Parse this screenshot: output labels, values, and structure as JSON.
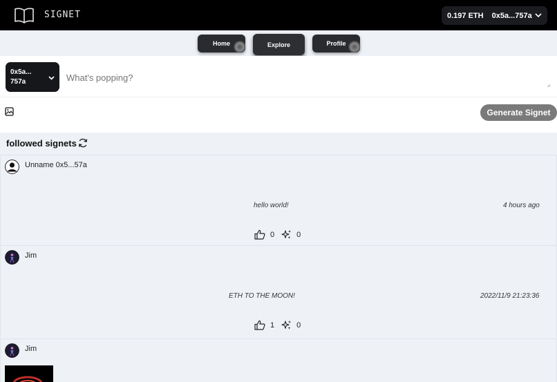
{
  "app": {
    "name": "SIGNET"
  },
  "header": {
    "balance": "0.197 ETH",
    "address": "0x5a...757a"
  },
  "nav": {
    "tabs": [
      {
        "label": "Home"
      },
      {
        "label": "Explore"
      },
      {
        "label": "Profile"
      }
    ],
    "active": "Explore"
  },
  "composer": {
    "account_line1": "0x5a...",
    "account_line2": "757a",
    "placeholder": "What's popping?",
    "generate_label": "Generate Signet"
  },
  "feed": {
    "title": "followed signets",
    "posts": [
      {
        "author": "Unname 0x5...57a",
        "content": "hello world!",
        "time": "4 hours ago",
        "likes": "0",
        "sparks": "0"
      },
      {
        "author": "Jim",
        "content": "ETH TO THE MOON!",
        "time": "2022/11/9 21:23:36",
        "likes": "1",
        "sparks": "0"
      },
      {
        "author": "Jim"
      }
    ]
  },
  "colors": {
    "topbar": "#000000",
    "page_bg": "#eef1f6",
    "generate_button": "#7a7a7a",
    "nav_button": "#2a2b2f"
  }
}
